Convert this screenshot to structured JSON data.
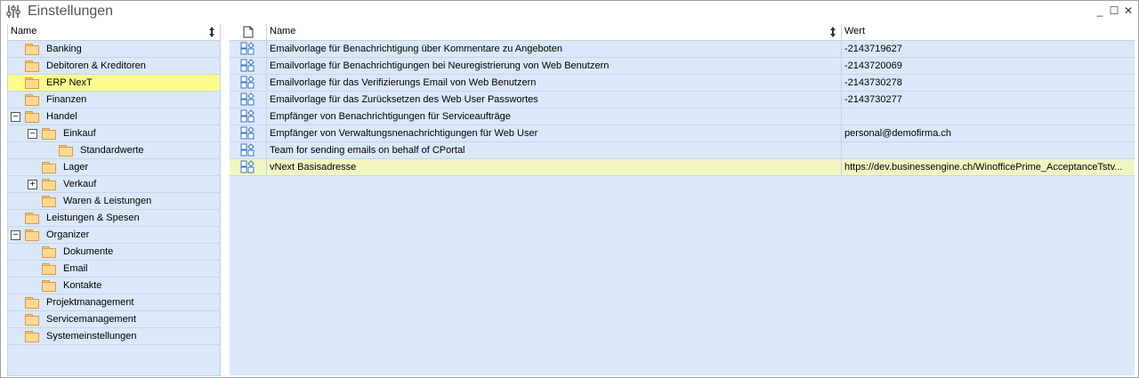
{
  "window": {
    "title": "Einstellungen",
    "icon": "settings-sliders-icon",
    "controls": [
      "minimize-icon",
      "maximize-icon",
      "close-icon"
    ]
  },
  "tree": {
    "header": "Name",
    "items": [
      {
        "label": "Banking",
        "level": 0,
        "expander": ""
      },
      {
        "label": "Debitoren & Kreditoren",
        "level": 0,
        "expander": ""
      },
      {
        "label": "ERP NexT",
        "level": 0,
        "expander": "",
        "selected": true
      },
      {
        "label": "Finanzen",
        "level": 0,
        "expander": ""
      },
      {
        "label": "Handel",
        "level": 0,
        "expander": "−"
      },
      {
        "label": "Einkauf",
        "level": 1,
        "expander": "−"
      },
      {
        "label": "Standardwerte",
        "level": 2,
        "expander": ""
      },
      {
        "label": "Lager",
        "level": 1,
        "expander": ""
      },
      {
        "label": "Verkauf",
        "level": 1,
        "expander": "+"
      },
      {
        "label": "Waren & Leistungen",
        "level": 1,
        "expander": ""
      },
      {
        "label": "Leistungen & Spesen",
        "level": 0,
        "expander": ""
      },
      {
        "label": "Organizer",
        "level": 0,
        "expander": "−"
      },
      {
        "label": "Dokumente",
        "level": 1,
        "expander": ""
      },
      {
        "label": "Email",
        "level": 1,
        "expander": ""
      },
      {
        "label": "Kontakte",
        "level": 1,
        "expander": ""
      },
      {
        "label": "Projektmanagement",
        "level": 0,
        "expander": ""
      },
      {
        "label": "Servicemanagement",
        "level": 0,
        "expander": ""
      },
      {
        "label": "Systemeinstellungen",
        "level": 0,
        "expander": ""
      }
    ]
  },
  "grid": {
    "columns": {
      "icon": "document-icon",
      "name": "Name",
      "value": "Wert"
    },
    "rows": [
      {
        "name": "Emailvorlage für Benachrichtigung über Kommentare zu Angeboten",
        "value": "-2143719627"
      },
      {
        "name": "Emailvorlage für Benachrichtigungen bei Neuregistrierung von Web Benutzern",
        "value": "-2143720069"
      },
      {
        "name": "Emailvorlage für das Verifizierungs Email von Web Benutzern",
        "value": "-2143730278"
      },
      {
        "name": "Emailvorlage für das Zurücksetzen des Web User Passwortes",
        "value": "-2143730277"
      },
      {
        "name": "Empfänger von Benachrichtigungen für Serviceaufträge",
        "value": ""
      },
      {
        "name": "Empfänger von Verwaltungsnenachrichtigungen für Web User",
        "value": "personal@demofirma.ch"
      },
      {
        "name": "Team for sending emails on behalf of CPortal",
        "value": ""
      },
      {
        "name": "vNext Basisadresse",
        "value": "https://dev.businessengine.ch/WinofficePrime_AcceptanceTstv...",
        "highlighted": true
      }
    ]
  },
  "colors": {
    "panel_bg": "#dbe8fa",
    "selected_bg": "#fbfc8d",
    "highlight_row_bg": "#f1f5c4",
    "folder": "#fdd894"
  }
}
